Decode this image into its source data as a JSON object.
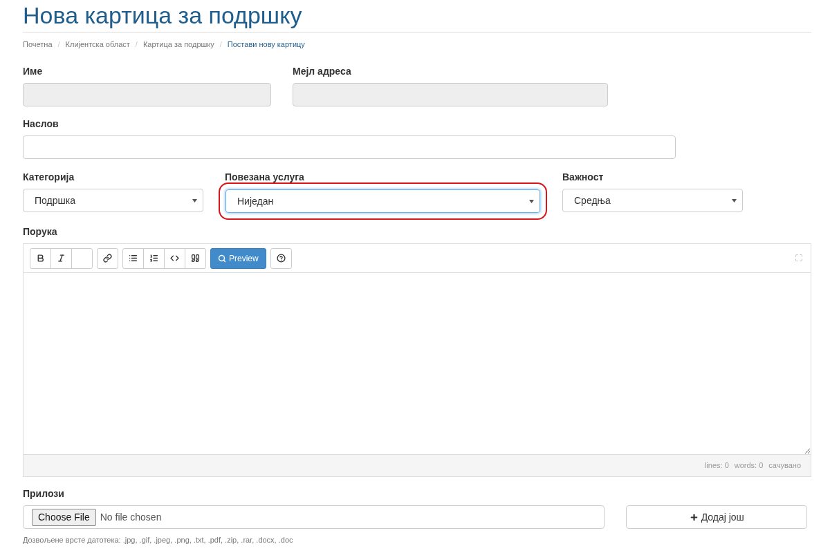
{
  "title": "Нова картица за подршку",
  "breadcrumb_separator": "/",
  "breadcrumb": [
    {
      "label": "Почетна",
      "current": false
    },
    {
      "label": "Клијентска област",
      "current": false
    },
    {
      "label": "Картица за подршку",
      "current": false
    },
    {
      "label": "Постави нову картицу",
      "current": true
    }
  ],
  "name": {
    "label": "Име",
    "disabled": true
  },
  "email": {
    "label": "Мејл адреса",
    "disabled": true
  },
  "subject": {
    "label": "Наслов"
  },
  "selects": [
    {
      "label": "Категорија",
      "value": "Подршка",
      "highlighted": false
    },
    {
      "label": "Повезана услуга",
      "value": "Ниједан",
      "highlighted": true
    },
    {
      "label": "Важност",
      "value": "Средња",
      "highlighted": false
    }
  ],
  "message": {
    "label": "Порука",
    "toolbar": [
      [
        {
          "kind": "bold"
        },
        {
          "kind": "italic"
        },
        {
          "kind": "blank"
        }
      ],
      [
        {
          "kind": "link"
        }
      ],
      [
        {
          "kind": "list"
        },
        {
          "kind": "ordered"
        },
        {
          "kind": "code"
        },
        {
          "kind": "quote"
        }
      ],
      [
        {
          "kind": "preview",
          "label": "Preview"
        }
      ],
      [
        {
          "kind": "help"
        }
      ]
    ],
    "status": [
      "lines: 0",
      "words: 0",
      "сачувано"
    ]
  },
  "attachments": {
    "label": "Прилози",
    "choose": "Choose File",
    "file": "No file chosen",
    "add": "Додај још",
    "hint": "Дозвољене врсте датотека: .jpg, .gif, .jpeg, .png, .txt, .pdf, .zip, .rar, .docx, .doc"
  }
}
